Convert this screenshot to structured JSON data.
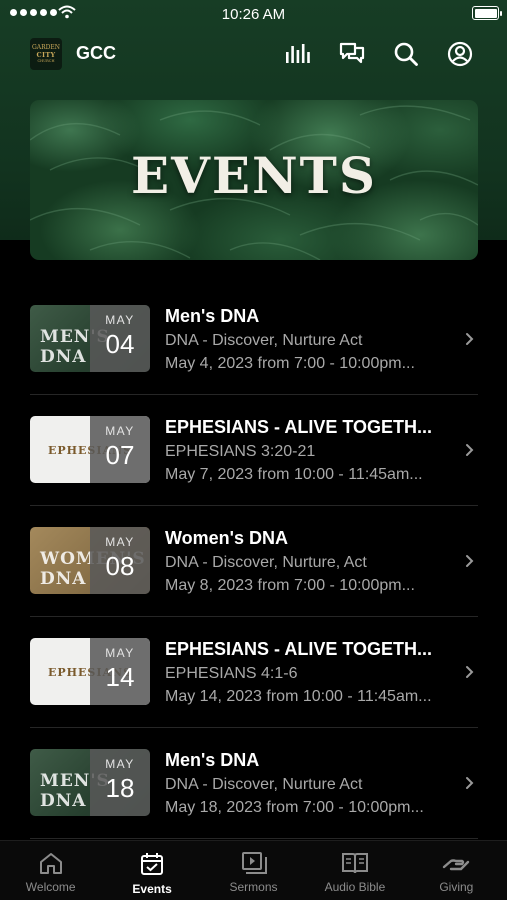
{
  "status": {
    "time": "10:26 AM"
  },
  "header": {
    "title": "GCC",
    "logo_lines": [
      "GARDEN",
      "CITY",
      "CHURCH"
    ]
  },
  "banner": {
    "title": "EVENTS"
  },
  "events": [
    {
      "title": "Men's DNA",
      "subtitle": "DNA - Discover, Nurture Act",
      "when": "May 4, 2023 from 7:00 - 10:00pm...",
      "month": "MAY",
      "day": "04",
      "thumb_text": "MEN'S DNA"
    },
    {
      "title": "EPHESIANS - ALIVE TOGETH...",
      "subtitle": "EPHESIANS 3:20-21",
      "when": "May 7, 2023 from 10:00 - 11:45am...",
      "month": "MAY",
      "day": "07",
      "thumb_text": "EPHESIANS"
    },
    {
      "title": "Women's DNA",
      "subtitle": "DNA - Discover, Nurture, Act",
      "when": "May 8, 2023 from 7:00 - 10:00pm...",
      "month": "MAY",
      "day": "08",
      "thumb_text": "WOMEN'S DNA"
    },
    {
      "title": "EPHESIANS - ALIVE TOGETH...",
      "subtitle": "EPHESIANS 4:1-6",
      "when": "May 14, 2023 from 10:00 - 11:45am...",
      "month": "MAY",
      "day": "14",
      "thumb_text": "EPHESIANS"
    },
    {
      "title": "Men's DNA",
      "subtitle": "DNA - Discover, Nurture Act",
      "when": "May 18, 2023 from 7:00 - 10:00pm...",
      "month": "MAY",
      "day": "18",
      "thumb_text": "MEN'S DNA"
    }
  ],
  "tabs": [
    {
      "label": "Welcome",
      "icon": "home-icon",
      "active": false
    },
    {
      "label": "Events",
      "icon": "calendar-icon",
      "active": true
    },
    {
      "label": "Sermons",
      "icon": "video-icon",
      "active": false
    },
    {
      "label": "Audio Bible",
      "icon": "book-icon",
      "active": false
    },
    {
      "label": "Giving",
      "icon": "giving-hand-icon",
      "active": false
    }
  ],
  "colors": {
    "background": "#000000",
    "header_green": "#173d25",
    "subtext_gray": "#a9a9a9",
    "inactive_tab": "#8c8c8c"
  }
}
